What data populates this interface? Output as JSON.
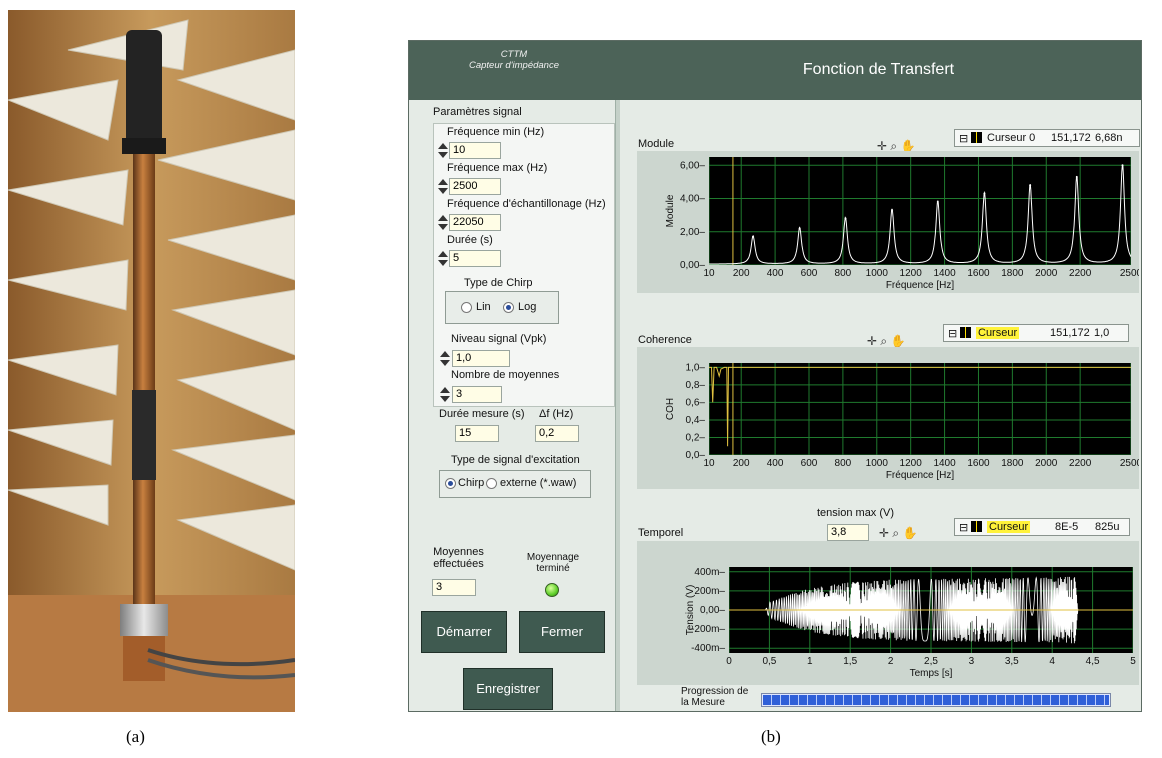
{
  "captions": {
    "left": "(a)",
    "right": "(b)"
  },
  "header": {
    "app_line1": "CTTM",
    "app_line2": "Capteur d'impédance",
    "title": "Fonction de Transfert"
  },
  "params": {
    "section": "Paramètres signal",
    "fmin_label": "Fréquence min (Hz)",
    "fmin_value": "10",
    "fmax_label": "Fréquence max (Hz)",
    "fmax_value": "2500",
    "fs_label": "Fréquence d'échantillonage (Hz)",
    "fs_value": "22050",
    "duree_label": "Durée (s)",
    "duree_value": "5",
    "chirp_label": "Type de Chirp",
    "chirp_lin": "Lin",
    "chirp_log": "Log",
    "chirp_selected": "Log",
    "niveau_label": "Niveau signal (Vpk)",
    "niveau_value": "1,0",
    "moy_label": "Nombre de moyennes",
    "moy_value": "3"
  },
  "measure": {
    "duree_label": "Durée mesure (s)",
    "duree_value": "15",
    "df_label": "Δf (Hz)",
    "df_value": "0,2"
  },
  "excitation": {
    "label": "Type de signal d'excitation",
    "chirp": "Chirp",
    "externe": "externe (*.waw)",
    "selected": "Chirp"
  },
  "averaging": {
    "done_label_1": "Moyennes",
    "done_label_2": "effectuées",
    "done_value": "3",
    "finished_label_1": "Moyennage",
    "finished_label_2": "terminé",
    "led_color": "#5fd02a"
  },
  "buttons": {
    "start": "Démarrer",
    "close": "Fermer",
    "save": "Enregistrer"
  },
  "progress": {
    "label_1": "Progression de",
    "label_2": "la Mesure",
    "fraction": 1.0
  },
  "graphs": {
    "module": {
      "label": "Module",
      "cursor_name": "Curseur 0",
      "cursor_x": "151,172",
      "cursor_y": "6,68n"
    },
    "coherence": {
      "label": "Coherence",
      "cursor_name": "Curseur",
      "cursor_x": "151,172",
      "cursor_y": "1,0"
    },
    "temporel": {
      "label": "Temporel",
      "tension_label": "tension max (V)",
      "tension_value": "3,8",
      "cursor_name": "Curseur",
      "cursor_x": "8E-5",
      "cursor_y": "825u"
    }
  },
  "colors": {
    "header": "#4c6358",
    "plot_bg": "#000000",
    "grid": "#1f7a2e",
    "cursor_line": "#e0c040",
    "trace": "#ffffff"
  },
  "chart_data": [
    {
      "type": "line",
      "ylabel": "Module",
      "xlabel": "Fréquence [Hz]",
      "xlim": [
        10,
        2500
      ],
      "ylim": [
        0,
        6.5
      ],
      "x_ticks": [
        10,
        200,
        400,
        600,
        800,
        1000,
        1200,
        1400,
        1600,
        1800,
        2000,
        2200,
        2500
      ],
      "y_ticks": [
        "0,00",
        "2,00",
        "4,00",
        "6,00"
      ],
      "y_tick_values": [
        0,
        2,
        4,
        6
      ],
      "cursor_x": 151.172,
      "peaks": [
        {
          "x": 270,
          "y": 1.7
        },
        {
          "x": 545,
          "y": 2.2
        },
        {
          "x": 815,
          "y": 2.8
        },
        {
          "x": 1090,
          "y": 3.3
        },
        {
          "x": 1360,
          "y": 3.8
        },
        {
          "x": 1635,
          "y": 4.3
        },
        {
          "x": 1905,
          "y": 4.8
        },
        {
          "x": 2180,
          "y": 5.3
        },
        {
          "x": 2450,
          "y": 6.0
        }
      ]
    },
    {
      "type": "line",
      "ylabel": "COH",
      "xlabel": "Fréquence [Hz]",
      "xlim": [
        10,
        2500
      ],
      "ylim": [
        0,
        1.05
      ],
      "x_ticks": [
        10,
        200,
        400,
        600,
        800,
        1000,
        1200,
        1400,
        1600,
        1800,
        2000,
        2200,
        2500
      ],
      "y_ticks": [
        "0,0",
        "0,2",
        "0,4",
        "0,6",
        "0,8",
        "1,0"
      ],
      "y_tick_values": [
        0,
        0.2,
        0.4,
        0.6,
        0.8,
        1.0
      ],
      "cursor_x": 151.172,
      "points": [
        [
          10,
          1.0
        ],
        [
          25,
          1.0
        ],
        [
          32,
          0.6
        ],
        [
          40,
          1.0
        ],
        [
          55,
          1.0
        ],
        [
          70,
          0.9
        ],
        [
          80,
          0.98
        ],
        [
          100,
          1.0
        ],
        [
          115,
          1.0
        ],
        [
          120,
          0.1
        ],
        [
          125,
          1.0
        ],
        [
          150,
          1.0
        ],
        [
          2500,
          1.0
        ]
      ]
    },
    {
      "type": "line",
      "ylabel": "Tension (V)",
      "xlabel": "Temps [s]",
      "xlim": [
        0,
        5
      ],
      "ylim": [
        -450,
        450
      ],
      "x_ticks": [
        "0",
        "0,5",
        "1",
        "1,5",
        "2",
        "2,5",
        "3",
        "3,5",
        "4",
        "4,5",
        "5"
      ],
      "x_tick_values": [
        0,
        0.5,
        1,
        1.5,
        2,
        2.5,
        3,
        3.5,
        4,
        4.5,
        5
      ],
      "y_ticks": [
        "-400m",
        "-200m",
        "0,00",
        "200m",
        "400m"
      ],
      "y_tick_values": [
        -400,
        -200,
        0,
        200,
        400
      ],
      "envelope": [
        [
          0.45,
          0
        ],
        [
          0.5,
          80
        ],
        [
          0.75,
          160
        ],
        [
          1.0,
          230
        ],
        [
          1.5,
          290
        ],
        [
          2.0,
          320
        ],
        [
          3.0,
          330
        ],
        [
          4.0,
          340
        ],
        [
          4.3,
          350
        ],
        [
          4.32,
          0
        ]
      ]
    }
  ]
}
